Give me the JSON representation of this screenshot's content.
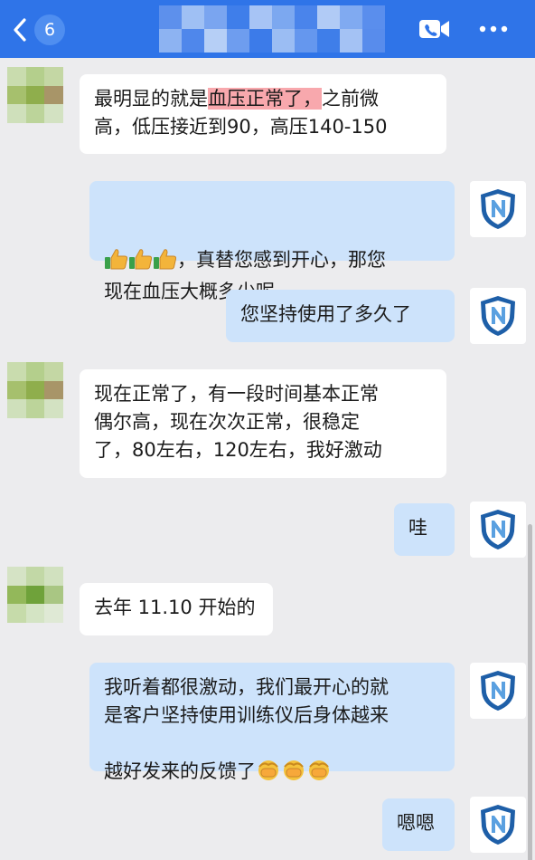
{
  "header": {
    "unread_count": "6",
    "title": "chat-title-redacted",
    "colors": {
      "bar": "#2f74e8",
      "badge": "#4f8ef0"
    }
  },
  "messages": [
    {
      "side": "in",
      "pre": "最明显的就是",
      "highlight": "血压正常了，",
      "post": "之前微\n高，低压接近到90，高压140-150"
    },
    {
      "side": "out",
      "text": "，真替您感到开心，那您\n现在血压大概多少呢",
      "emoji_prefix": "thumbs-up-icon x3"
    },
    {
      "side": "out",
      "text": "您坚持使用了多久了"
    },
    {
      "side": "in",
      "text": "现在正常了，有一段时间基本正常\n偶尔高，现在次次正常，很稳定\n了，80左右，120左右，我好激动"
    },
    {
      "side": "out",
      "text": "哇"
    },
    {
      "side": "in",
      "text": "去年 11.10 开始的"
    },
    {
      "side": "out",
      "text": "我听着都很激动，我们最开心的就\n是客户坚持使用训练仪后身体越来\n越好发来的反馈了",
      "emoji_suffix": "fist-bump-icon x3"
    },
    {
      "side": "out",
      "text": "嗯嗯"
    }
  ],
  "colors": {
    "incoming": "#ffffff",
    "outgoing": "#cde3fb",
    "highlight": "#f8a8ad",
    "background": "#ececee"
  }
}
